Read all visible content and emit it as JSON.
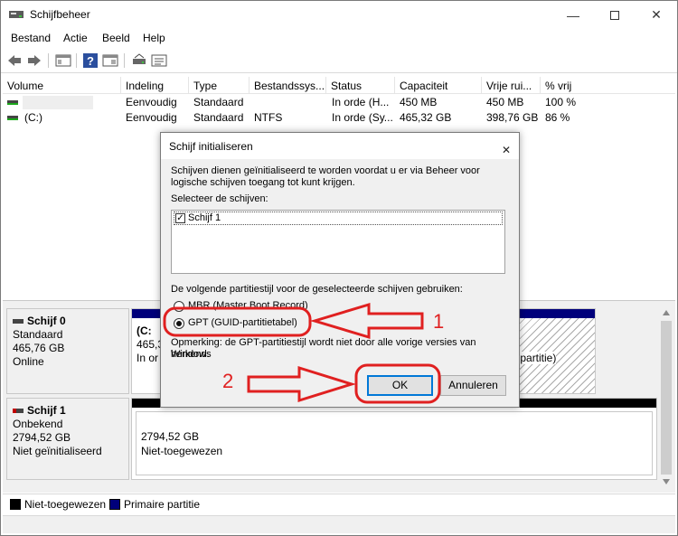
{
  "window": {
    "title": "Schijfbeheer"
  },
  "menu": [
    "Bestand",
    "Actie",
    "Beeld",
    "Help"
  ],
  "columns": [
    "Volume",
    "Indeling",
    "Type",
    "Bestandssys...",
    "Status",
    "Capaciteit",
    "Vrije rui...",
    "% vrij"
  ],
  "volumes": [
    {
      "volume": "",
      "indeling": "Eenvoudig",
      "type": "Standaard",
      "fs": "",
      "status": "In orde (H...",
      "capaciteit": "450 MB",
      "vrij": "450 MB",
      "pct": "100 %"
    },
    {
      "volume": "(C:)",
      "indeling": "Eenvoudig",
      "type": "Standaard",
      "fs": "NTFS",
      "status": "In orde (Sy...",
      "capaciteit": "465,32 GB",
      "vrij": "398,76 GB",
      "pct": "86 %"
    }
  ],
  "disk0": {
    "name": "Schijf 0",
    "type": "Standaard",
    "size": "465,76 GB",
    "state": "Online",
    "part_c_label": "(C:",
    "part_c_size": "465,3",
    "part_c_status": "In or",
    "part_right": "elpartitie)"
  },
  "disk1": {
    "name": "Schijf 1",
    "type": "Onbekend",
    "size": "2794,52 GB",
    "state": "Niet geïnitialiseerd",
    "unalloc_size": "2794,52 GB",
    "unalloc_label": "Niet-toegewezen"
  },
  "legend": {
    "unallocated": "Niet-toegewezen",
    "primary": "Primaire partitie"
  },
  "dialog": {
    "title": "Schijf initialiseren",
    "intro_line1": "Schijven dienen geïnitialiseerd te worden voordat u er via Beheer voor",
    "intro_line2": "logische schijven toegang tot kunt krijgen.",
    "select_label": "Selecteer de schijven:",
    "disk_item": "Schijf 1",
    "style_label": "De volgende partitiestijl voor de geselecteerde schijven gebruiken:",
    "mbr_label": "MBR (Master Boot Record)",
    "gpt_label": "GPT (GUID-partitietabel)",
    "note_line1": "Opmerking: de GPT-partitiestijl wordt niet door alle vorige versies van Windows",
    "note_line2": "herkend.",
    "ok_label": "OK",
    "cancel_label": "Annuleren"
  },
  "annotations": {
    "step1": "1",
    "step2": "2"
  },
  "colors": {
    "annotation": "#e02020",
    "primary_partition": "#00007b",
    "accent": "#0078d7"
  }
}
